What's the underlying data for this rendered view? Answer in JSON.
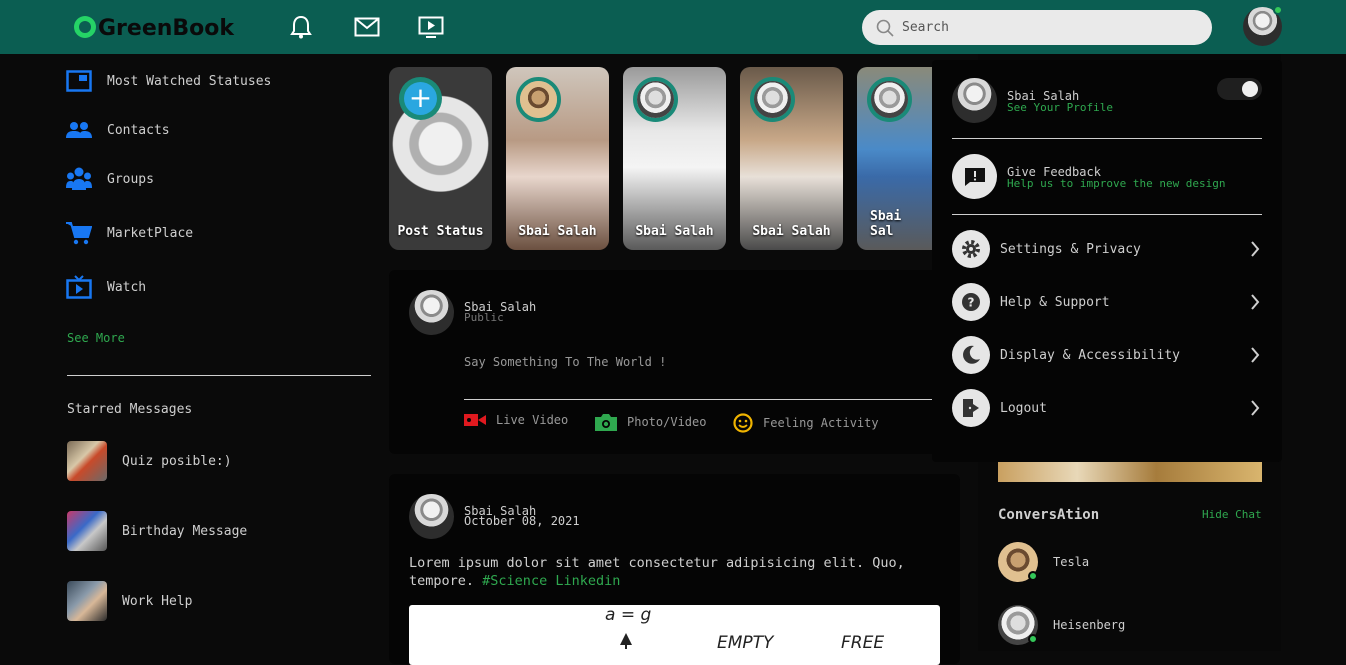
{
  "header": {
    "brand": "GreenBook",
    "search_placeholder": "Search"
  },
  "sidebar": {
    "items": [
      {
        "label": "Most Watched Statuses",
        "icon": "statuses-icon"
      },
      {
        "label": "Contacts",
        "icon": "contacts-icon"
      },
      {
        "label": "Groups",
        "icon": "groups-icon"
      },
      {
        "label": "MarketPlace",
        "icon": "cart-icon"
      },
      {
        "label": "Watch",
        "icon": "watch-icon"
      }
    ],
    "see_more": "See More",
    "starred_title": "Starred Messages",
    "starred": [
      {
        "label": "Quiz posible:)"
      },
      {
        "label": "Birthday Message"
      },
      {
        "label": "Work Help"
      }
    ]
  },
  "stories": [
    {
      "name": "Post Status"
    },
    {
      "name": "Sbai Salah"
    },
    {
      "name": "Sbai Salah"
    },
    {
      "name": "Sbai Salah"
    },
    {
      "name": "Sbai Sal"
    }
  ],
  "composer": {
    "name": "Sbai Salah",
    "visibility": "Public",
    "placeholder": "Say Something To The World !",
    "actions": [
      {
        "label": "Live Video",
        "color": "#e0191f"
      },
      {
        "label": "Photo/Video",
        "color": "#2fa84f"
      },
      {
        "label": "Feeling Activity",
        "color": "#f0b400"
      }
    ]
  },
  "post": {
    "name": "Sbai Salah",
    "date": "October 08, 2021",
    "text": "Lorem ipsum dolor sit amet consectetur adipisicing elit. Quo, tempore.",
    "tags": "#Science Linkedin",
    "image_text": [
      "a = g",
      "EMPTY",
      "FREE"
    ]
  },
  "dropdown": {
    "profile_name": "Sbai Salah",
    "profile_link": "See Your Profile",
    "feedback_title": "Give Feedback",
    "feedback_sub": "Help us to improve the new design",
    "items": [
      {
        "label": "Settings & Privacy",
        "icon": "gear-icon"
      },
      {
        "label": "Help & Support",
        "icon": "help-icon"
      },
      {
        "label": "Display & Accessibility",
        "icon": "moon-icon"
      },
      {
        "label": "Logout",
        "icon": "logout-icon"
      }
    ]
  },
  "conversation": {
    "title": "ConversAtion",
    "hide": "Hide Chat",
    "contacts": [
      {
        "name": "Tesla"
      },
      {
        "name": "Heisenberg"
      }
    ]
  },
  "colors": {
    "header": "#0b5e52",
    "accent_green": "#2fa84f",
    "icon_blue": "#1877f2"
  }
}
